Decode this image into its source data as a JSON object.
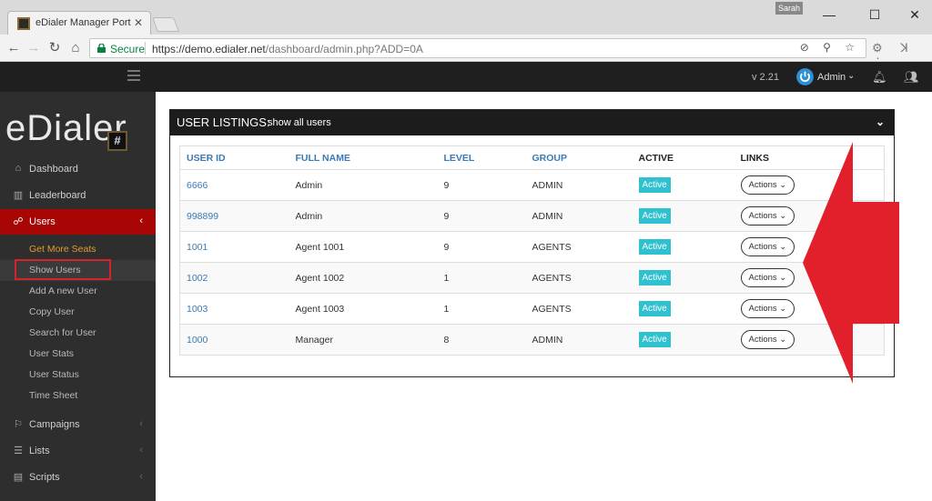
{
  "browser": {
    "tab_title": "eDialer Manager Portal |",
    "tab_close": "✕",
    "user_chip": "Sarah",
    "secure_label": "Secure",
    "url_scheme": "https://",
    "url_host": "demo.edialer.net",
    "url_path": "/dashboard/admin.php?ADD=0A",
    "window_controls": {
      "minimize": "—",
      "maximize": "☐",
      "close": "✕"
    }
  },
  "topbar": {
    "version": "v 2.21",
    "user_label": "Admin",
    "caret": "⌄",
    "icons": [
      "power-icon",
      "bell-icon",
      "users-group-icon",
      "hamburger-icon"
    ]
  },
  "sidebar": {
    "logo_text": "eDialer",
    "logo_mark": "#",
    "items": [
      {
        "label": "Dashboard",
        "icon": "home-icon"
      },
      {
        "label": "Leaderboard",
        "icon": "bar-chart-icon"
      },
      {
        "label": "Users",
        "icon": "users-icon",
        "active": true
      },
      {
        "label": "Campaigns",
        "icon": "flag-icon"
      },
      {
        "label": "Lists",
        "icon": "list-icon"
      },
      {
        "label": "Scripts",
        "icon": "script-icon"
      }
    ],
    "user_submenu": [
      "Get More Seats",
      "Show Users",
      "Add A new User",
      "Copy User",
      "Search for User",
      "User Stats",
      "User Status",
      "Time Sheet"
    ]
  },
  "panel": {
    "title": "USER LISTINGS:",
    "subtitle": "show all users",
    "toggle": "⌄",
    "columns": [
      "USER ID",
      "FULL NAME",
      "LEVEL",
      "GROUP",
      "ACTIVE",
      "LINKS"
    ],
    "rows": [
      {
        "user_id": "6666",
        "full_name": "Admin",
        "level": "9",
        "group": "ADMIN",
        "active": "Active",
        "links": "Actions ⌄"
      },
      {
        "user_id": "998899",
        "full_name": "Admin",
        "level": "9",
        "group": "ADMIN",
        "active": "Active",
        "links": "Actions ⌄"
      },
      {
        "user_id": "1001",
        "full_name": "Agent 1001",
        "level": "9",
        "group": "AGENTS",
        "active": "Active",
        "links": "Actions ⌄"
      },
      {
        "user_id": "1002",
        "full_name": "Agent 1002",
        "level": "1",
        "group": "AGENTS",
        "active": "Active",
        "links": "Actions ⌄"
      },
      {
        "user_id": "1003",
        "full_name": "Agent 1003",
        "level": "1",
        "group": "AGENTS",
        "active": "Active",
        "links": "Actions ⌄"
      },
      {
        "user_id": "1000",
        "full_name": "Manager",
        "level": "8",
        "group": "ADMIN",
        "active": "Active",
        "links": "Actions ⌄"
      }
    ]
  },
  "colors": {
    "sidebar_bg": "#2e2e2e",
    "active_nav": "#a80505",
    "submenu_orange": "#e49a2e",
    "link_blue": "#3a7ab5",
    "active_badge": "#2fc1cf",
    "annotation_red": "#e2202b"
  }
}
